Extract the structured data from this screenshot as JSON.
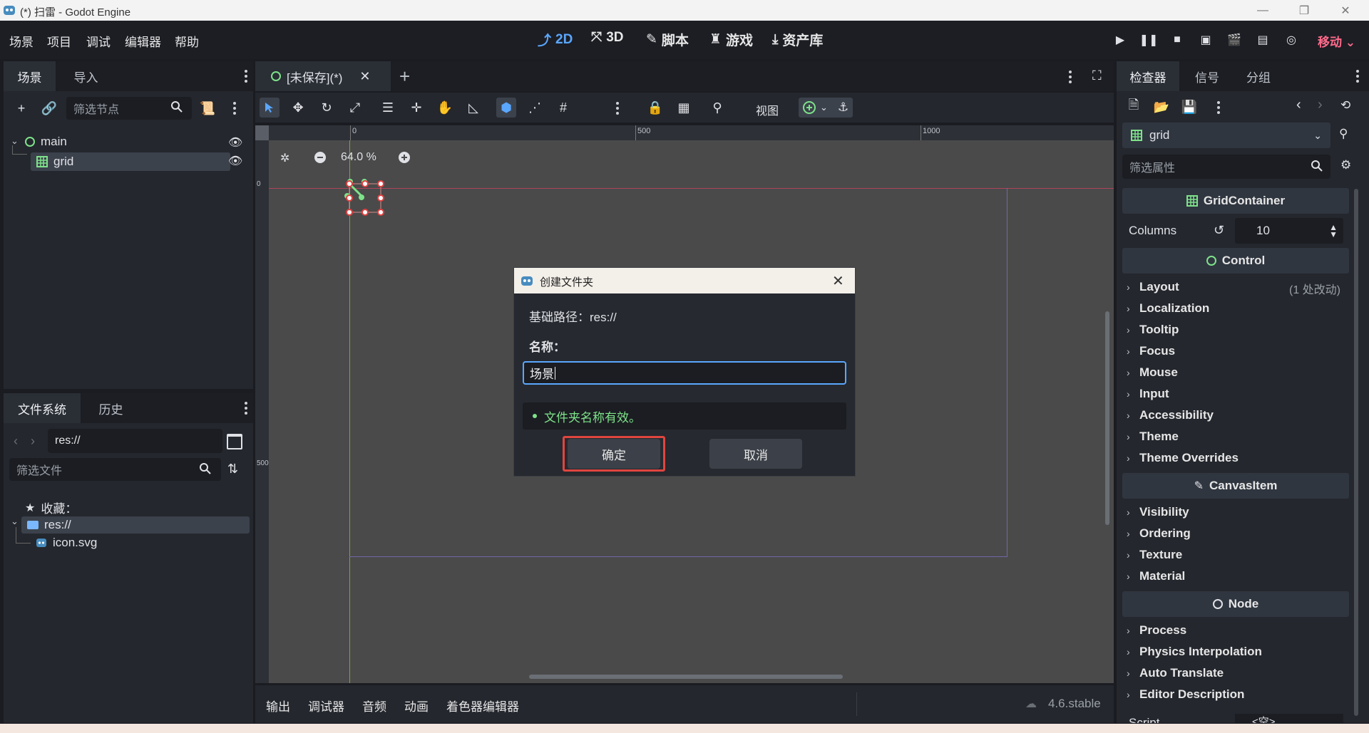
{
  "window": {
    "title": "(*) 扫雷 - Godot Engine"
  },
  "menu": {
    "items": [
      "场景",
      "项目",
      "调试",
      "编辑器",
      "帮助"
    ]
  },
  "workspaces": {
    "w2d": "2D",
    "w3d": "3D",
    "script": "脚本",
    "game": "游戏",
    "assetlib": "资产库"
  },
  "run_mode": "移动",
  "scene_panel": {
    "tabs": [
      "场景",
      "导入"
    ],
    "filter_placeholder": "筛选节点",
    "tree": {
      "root": "main",
      "child": "grid"
    }
  },
  "fs_panel": {
    "tabs": [
      "文件系统",
      "历史"
    ],
    "path": "res://",
    "filter_placeholder": "筛选文件",
    "favorites": "收藏：",
    "root": "res://",
    "file": "icon.svg"
  },
  "editor_tab": {
    "label": "[未保存](*)"
  },
  "toolbar": {
    "view": "视图"
  },
  "canvas": {
    "zoom": "64.0 %",
    "ruler_top": [
      "0",
      "500",
      "1000"
    ],
    "ruler_left": [
      "0",
      "500"
    ]
  },
  "dialog": {
    "title": "创建文件夹",
    "base_path": "基础路径：res://",
    "name_label": "名称：",
    "name_value": "场景",
    "status": "文件夹名称有效。",
    "ok": "确定",
    "cancel": "取消",
    "status_color": "#7ee28a",
    "highlight_color": "#e0453f"
  },
  "inspector": {
    "tabs": [
      "检查器",
      "信号",
      "分组"
    ],
    "node_name": "grid",
    "filter_placeholder": "筛选属性",
    "section_grid": "GridContainer",
    "columns_label": "Columns",
    "columns_value": "10",
    "section_control": "Control",
    "control_props": [
      "Layout",
      "Localization",
      "Tooltip",
      "Focus",
      "Mouse",
      "Input",
      "Accessibility",
      "Theme",
      "Theme Overrides"
    ],
    "layout_note": "(1 处改动)",
    "section_canvasitem": "CanvasItem",
    "canvas_props": [
      "Visibility",
      "Ordering",
      "Texture",
      "Material"
    ],
    "section_node": "Node",
    "node_props": [
      "Process",
      "Physics Interpolation",
      "Auto Translate",
      "Editor Description"
    ],
    "script_label": "Script",
    "script_value": "<空>"
  },
  "bottom": {
    "tabs": [
      "输出",
      "调试器",
      "音频",
      "动画",
      "着色器编辑器"
    ],
    "version": "4.6.stable"
  },
  "colors": {
    "accent": "#5aa7ff",
    "run_mode": "#ff6b8b",
    "node_green": "#7ee28a"
  }
}
